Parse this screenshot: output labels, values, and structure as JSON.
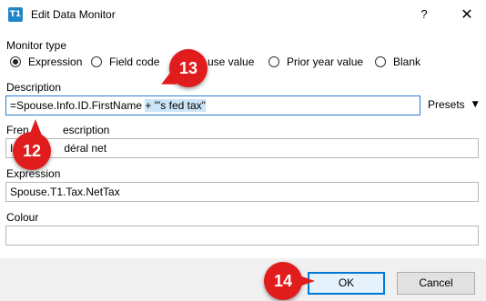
{
  "window": {
    "title": "Edit Data Monitor",
    "app_icon_text": "T1",
    "help_label": "?",
    "close_label": "✕"
  },
  "monitor_type": {
    "label": "Monitor type",
    "options": [
      {
        "label": "Expression",
        "selected": true
      },
      {
        "label": "Field code",
        "selected": false
      },
      {
        "label": "use value",
        "selected": false
      },
      {
        "label": "Prior year value",
        "selected": false
      },
      {
        "label": "Blank",
        "selected": false
      }
    ]
  },
  "description": {
    "label": "Description",
    "value_plain": "=Spouse.Info.ID.FirstName ",
    "value_selected": "+ \"'s fed tax\"",
    "presets_label": "Presets",
    "presets_arrow": "▼"
  },
  "french_description": {
    "label_left": "Fren",
    "label_right": "escription",
    "value_left": "I",
    "value_right": "déral net"
  },
  "expression": {
    "label": "Expression",
    "value": "Spouse.T1.Tax.NetTax"
  },
  "colour": {
    "label": "Colour",
    "value": ""
  },
  "buttons": {
    "ok": "OK",
    "cancel": "Cancel"
  },
  "callouts": {
    "c12": "12",
    "c13": "13",
    "c14": "14"
  },
  "colors": {
    "accent": "#0078d7",
    "callout": "#e11c1c",
    "selection": "#cce4f7"
  }
}
